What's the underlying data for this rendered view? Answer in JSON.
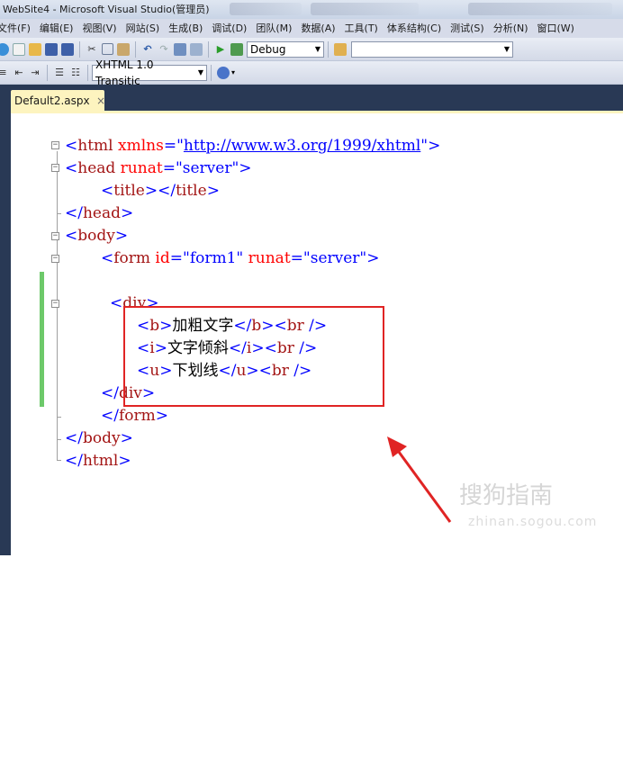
{
  "window": {
    "title": "WebSite4 - Microsoft Visual Studio(管理员)"
  },
  "menu": {
    "items": [
      "文件(F)",
      "编辑(E)",
      "视图(V)",
      "网站(S)",
      "生成(B)",
      "调试(D)",
      "团队(M)",
      "数据(A)",
      "工具(T)",
      "体系结构(C)",
      "测试(S)",
      "分析(N)",
      "窗口(W)"
    ]
  },
  "toolbar": {
    "config_value": "Debug",
    "search_value": "",
    "doctype_value": "XHTML 1.0 Transitic",
    "icons": [
      "new-project-icon",
      "add-item-icon",
      "open-file-icon",
      "save-icon",
      "save-all-icon",
      "cut-icon",
      "copy-icon",
      "paste-icon",
      "undo-icon",
      "redo-icon",
      "navigate-icon",
      "start-debug-icon",
      "find-icon",
      "indent-icon",
      "outdent-icon",
      "comment-icon",
      "uncomment-icon",
      "browse-icon"
    ]
  },
  "tab": {
    "label": "Default2.aspx",
    "close": "×"
  },
  "code": {
    "l1": {
      "open": "<",
      "tag": "html",
      "attr": " xmlns",
      "eq": "=",
      "q1": "\"",
      "url": "http://www.w3.org/1999/xhtml",
      "q2": "\"",
      "close": ">"
    },
    "l2": {
      "open": "<",
      "tag": "head",
      "attr": " runat",
      "eq": "=",
      "val": "\"server\"",
      "close": ">"
    },
    "l3": {
      "open": "<",
      "tag": "title",
      "mid": "></",
      "tag2": "title",
      "close": ">"
    },
    "l4": {
      "open": "</",
      "tag": "head",
      "close": ">"
    },
    "l5": {
      "open": "<",
      "tag": "body",
      "close": ">"
    },
    "l6": {
      "open": "<",
      "tag": "form",
      "attr": " id",
      "eq": "=",
      "val": "\"form1\"",
      "attr2": " runat",
      "eq2": "=",
      "val2": "\"server\"",
      "close": ">"
    },
    "l7": {
      "open": "<",
      "tag": "div",
      "close": ">"
    },
    "l8": {
      "open": "<",
      "tag": "b",
      "close": ">",
      "text": "加粗文字",
      "open2": "</",
      "tag2": "b",
      "close2": "><",
      "tag3": "br",
      "close3": " />"
    },
    "l9": {
      "open": "<",
      "tag": "i",
      "close": ">",
      "text": "文字倾斜",
      "open2": "</",
      "tag2": "i",
      "close2": "><",
      "tag3": "br",
      "close3": " />"
    },
    "l10": {
      "open": "<",
      "tag": "u",
      "close": ">",
      "text": "下划线",
      "open2": "</",
      "tag2": "u",
      "close2": "><",
      "tag3": "br",
      "close3": " />"
    },
    "l11": {
      "open": "</",
      "tag": "div",
      "close": ">"
    },
    "l12": {
      "open": "</",
      "tag": "form",
      "close": ">"
    },
    "l13": {
      "open": "</",
      "tag": "body",
      "close": ">"
    },
    "l14": {
      "open": "</",
      "tag": "html",
      "close": ">"
    }
  },
  "watermark": {
    "main": "搜狗指南",
    "sub": "zhinan.sogou.com"
  },
  "colors": {
    "keyword_blue": "#0000ff",
    "tag_maroon": "#a31515",
    "attr_red": "#ff0000",
    "annotation_red": "#e02424",
    "tab_yellow": "#fdf4bf",
    "frame_navy": "#293955",
    "change_green": "#6dc96a"
  }
}
